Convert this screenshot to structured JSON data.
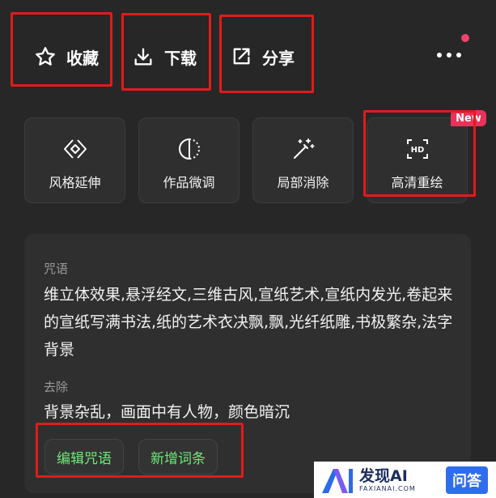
{
  "actions": {
    "collect_label": "收藏",
    "download_label": "下载",
    "share_label": "分享"
  },
  "tools": [
    {
      "label": "风格延伸",
      "icon": "diamond-icon"
    },
    {
      "label": "作品微调",
      "icon": "half-circle-icon"
    },
    {
      "label": "局部消除",
      "icon": "magic-wand-icon"
    },
    {
      "label": "高清重绘",
      "icon": "hd-icon",
      "badge": "New"
    }
  ],
  "prompt": {
    "label": "咒语",
    "text": "维立体效果,悬浮经文,三维古风,宣纸艺术,宣纸内发光,卷起来的宣纸写满书法,纸的艺术衣决飘,飘,光纤纸雕,书极繁杂,法字背景"
  },
  "negative": {
    "label": "去除",
    "text": "背景杂乱，画面中有人物，颜色暗沉"
  },
  "buttons": {
    "edit_prompt": "编辑咒语",
    "add_term": "新增词条"
  },
  "watermark": {
    "logo_text": "AI",
    "brand": "发现AI",
    "brand_sub": "FAXIANAI.COM",
    "qa": "问答"
  },
  "colors": {
    "background": "#272727",
    "panel": "#2f2f2f",
    "highlight_box": "#e01c1c",
    "new_badge": "#e8325a",
    "chip_text": "#6ee97a"
  }
}
